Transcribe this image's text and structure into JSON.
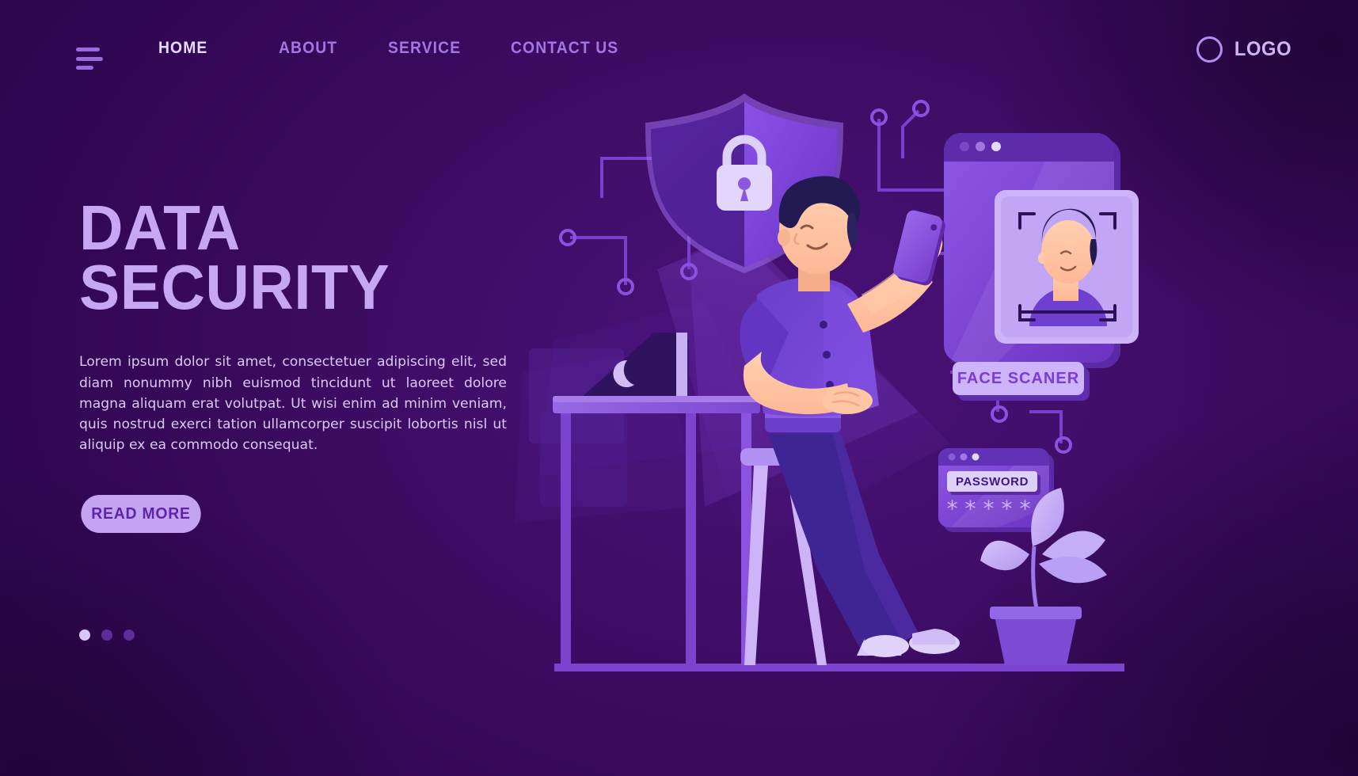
{
  "nav": {
    "menu_icon": "hamburger-icon",
    "links": [
      {
        "label": "HOME",
        "active": true
      },
      {
        "label": "ABOUT",
        "active": false
      },
      {
        "label": "SERVICE",
        "active": false
      },
      {
        "label": "CONTACT US",
        "active": false
      }
    ],
    "logo": {
      "icon": "circle-ring-icon",
      "text": "LOGO"
    }
  },
  "hero": {
    "title_line1": "DATA",
    "title_line2": "SECURITY",
    "paragraph": "Lorem ipsum dolor sit amet, consectetuer adipiscing elit, sed diam nonummy nibh euismod tincidunt ut laoreet dolore magna aliquam erat volutpat. Ut wisi enim ad minim veniam, quis nostrud exerci tation ullamcorper suscipit lobortis nisl ut aliquip ex ea commodo consequat.",
    "cta_label": "READ MORE",
    "carousel": {
      "total": 3,
      "active_index": 0
    }
  },
  "illustration": {
    "shield_icon": "shield-with-padlock-icon",
    "laptop_icon": "laptop-with-moon-logo",
    "phone_icon": "smartphone-in-hand",
    "face_scanner": {
      "window_dots": 3,
      "portrait": "person-portrait-icon",
      "frame": "scan-corner-brackets",
      "button_label": "FACE SCANER"
    },
    "password_window": {
      "window_dots": 3,
      "field_label": "PASSWORD",
      "masked_value": "*****"
    },
    "plant_icon": "potted-leaf-plant",
    "circuit_icon": "circuit-trace-nodes"
  },
  "colors": {
    "background_deep": "#2e0650",
    "background_mid": "#4a1178",
    "accent_lavender": "#c4a4f2",
    "accent_light": "#e6dcff",
    "nav_inactive": "#a377e2",
    "purple_violet": "#7a3fd6",
    "skin": "#ffc2a0",
    "hair_dark": "#241a52"
  }
}
